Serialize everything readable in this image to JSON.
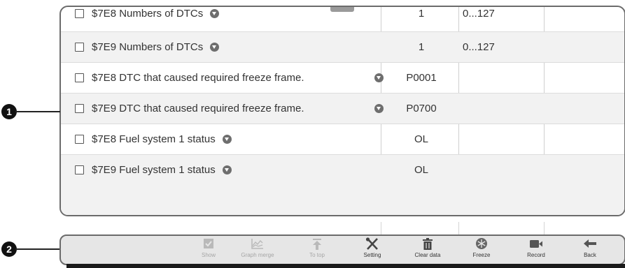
{
  "rows": [
    {
      "name": "$7E8 Numbers of DTCs",
      "value": "1",
      "range": "0...127"
    },
    {
      "name": "$7E9 Numbers of DTCs",
      "value": "1",
      "range": "0...127"
    },
    {
      "name": "$7E8 DTC that caused required freeze frame.",
      "value": "P0001",
      "range": ""
    },
    {
      "name": "$7E9 DTC that caused required freeze frame.",
      "value": "P0700",
      "range": ""
    },
    {
      "name": "$7E8 Fuel system 1 status",
      "value": "OL",
      "range": ""
    },
    {
      "name": "$7E9 Fuel system 1 status",
      "value": "OL",
      "range": ""
    }
  ],
  "callouts": {
    "one": "1",
    "two": "2"
  },
  "toolbar": {
    "show": "Show",
    "graph_merge": "Graph merge",
    "to_top": "To top",
    "setting": "Setting",
    "clear_data": "Clear data",
    "freeze": "Freeze",
    "record": "Record",
    "back": "Back"
  },
  "icons": [
    "show-icon",
    "graph-merge-icon",
    "to-top-icon",
    "setting-icon",
    "clear-data-icon",
    "freeze-icon",
    "record-icon",
    "back-icon",
    "info-dropdown-icon"
  ]
}
